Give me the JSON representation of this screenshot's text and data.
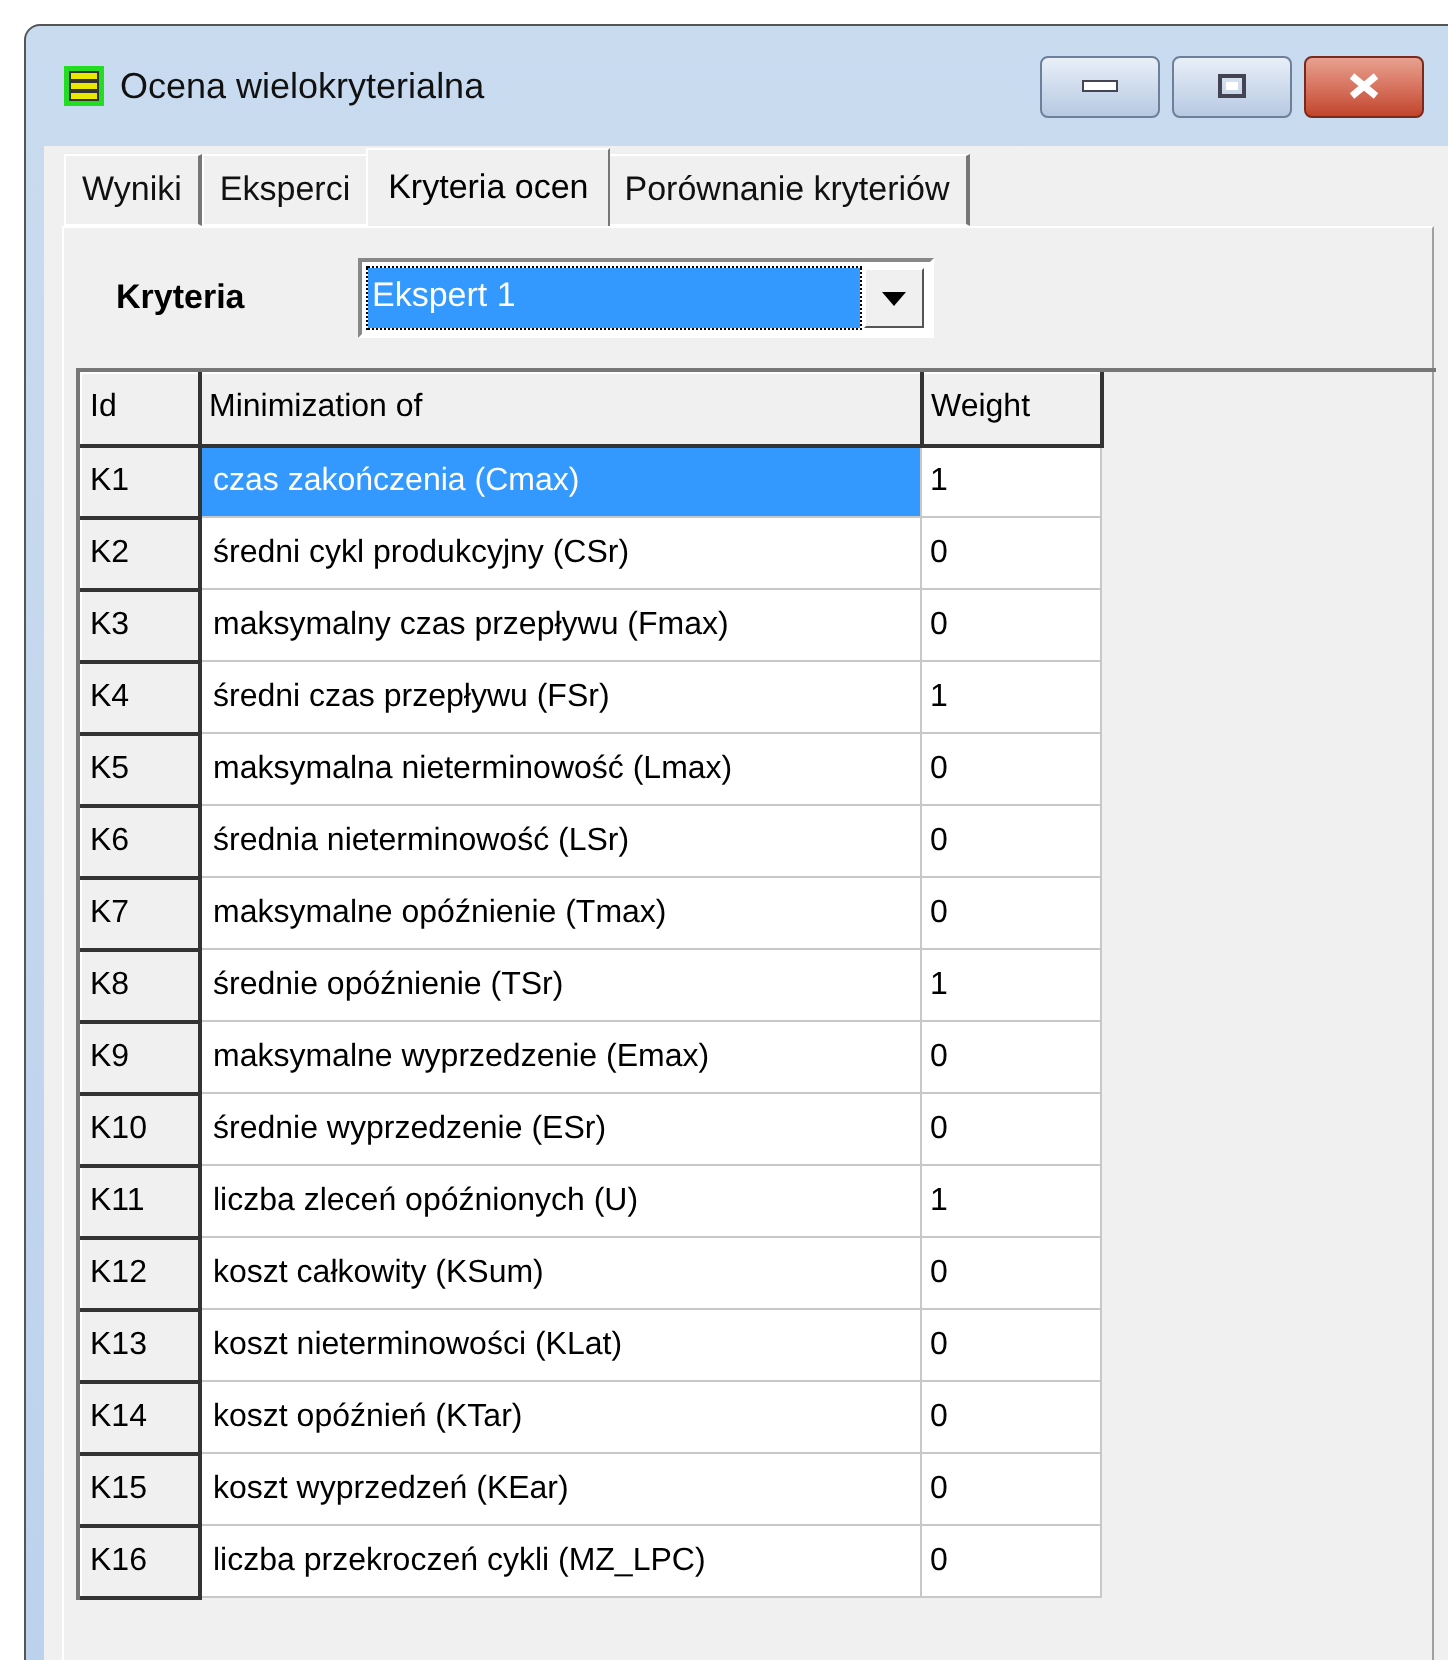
{
  "window": {
    "title": "Ocena wielokryterialna"
  },
  "tabs": [
    {
      "label": "Wyniki",
      "selected": false
    },
    {
      "label": "Eksperci",
      "selected": false
    },
    {
      "label": "Kryteria ocen",
      "selected": true
    },
    {
      "label": "Porównanie kryteriów",
      "selected": false
    }
  ],
  "criteria": {
    "label": "Kryteria",
    "value": "Ekspert 1"
  },
  "table": {
    "columns": [
      "Id",
      "Minimization of",
      "Weight"
    ],
    "rows": [
      {
        "id": "K1",
        "name": "czas zakończenia (Cmax)",
        "weight": "1",
        "selected": true
      },
      {
        "id": "K2",
        "name": "średni cykl produkcyjny (CSr)",
        "weight": "0",
        "selected": false
      },
      {
        "id": "K3",
        "name": "maksymalny czas przepływu (Fmax)",
        "weight": "0",
        "selected": false
      },
      {
        "id": "K4",
        "name": "średni czas przepływu (FSr)",
        "weight": "1",
        "selected": false
      },
      {
        "id": "K5",
        "name": "maksymalna nieterminowość (Lmax)",
        "weight": "0",
        "selected": false
      },
      {
        "id": "K6",
        "name": "średnia nieterminowość (LSr)",
        "weight": "0",
        "selected": false
      },
      {
        "id": "K7",
        "name": "maksymalne opóźnienie (Tmax)",
        "weight": "0",
        "selected": false
      },
      {
        "id": "K8",
        "name": "średnie opóźnienie (TSr)",
        "weight": "1",
        "selected": false
      },
      {
        "id": "K9",
        "name": "maksymalne wyprzedzenie (Emax)",
        "weight": "0",
        "selected": false
      },
      {
        "id": "K10",
        "name": "średnie wyprzedzenie (ESr)",
        "weight": "0",
        "selected": false
      },
      {
        "id": "K11",
        "name": "liczba zleceń opóźnionych (U)",
        "weight": "1",
        "selected": false
      },
      {
        "id": "K12",
        "name": "koszt całkowity (KSum)",
        "weight": "0",
        "selected": false
      },
      {
        "id": "K13",
        "name": "koszt nieterminowości (KLat)",
        "weight": "0",
        "selected": false
      },
      {
        "id": "K14",
        "name": "koszt opóźnień (KTar)",
        "weight": "0",
        "selected": false
      },
      {
        "id": "K15",
        "name": "koszt wyprzedzeń (KEar)",
        "weight": "0",
        "selected": false
      },
      {
        "id": "K16",
        "name": "liczba przekroczeń cykli (MZ_LPC)",
        "weight": "0",
        "selected": false
      }
    ]
  }
}
